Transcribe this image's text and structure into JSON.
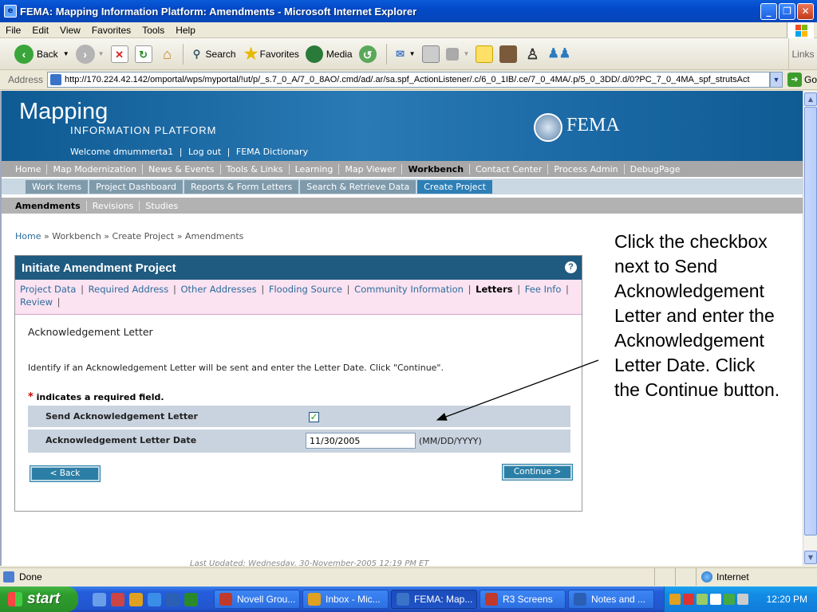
{
  "window": {
    "title": "FEMA: Mapping Information Platform: Amendments - Microsoft Internet Explorer",
    "minimize_icon": "minimize-icon",
    "maximize_icon": "restore-icon",
    "close_icon": "close-icon"
  },
  "menu": [
    "File",
    "Edit",
    "View",
    "Favorites",
    "Tools",
    "Help"
  ],
  "toolbar": {
    "back": "Back",
    "search": "Search",
    "favorites": "Favorites",
    "media": "Media",
    "links": "Links"
  },
  "address": {
    "label": "Address",
    "url": "http://170.224.42.142/omportal/wps/myportal/!ut/p/_s.7_0_A/7_0_8AO/.cmd/ad/.ar/sa.spf_ActionListener/.c/6_0_1IB/.ce/7_0_4MA/.p/5_0_3DD/.d/0?PC_7_0_4MA_spf_strutsAct",
    "go": "Go"
  },
  "banner": {
    "title": "Mapping",
    "subtitle": "INFORMATION PLATFORM",
    "welcome": "Welcome dmummerta1",
    "logout": "Log out",
    "dictionary": "FEMA Dictionary",
    "sep": "|",
    "logo_text": "FEMA"
  },
  "nav_main": [
    "Home",
    "Map Modernization",
    "News & Events",
    "Tools & Links",
    "Learning",
    "Map Viewer",
    "Workbench",
    "Contact Center",
    "Process Admin",
    "DebugPage"
  ],
  "nav_main_active": "Workbench",
  "nav_sub": [
    "Work Items",
    "Project Dashboard",
    "Reports & Form Letters",
    "Search & Retrieve Data",
    "Create Project"
  ],
  "nav_sub_active": "Create Project",
  "nav_tertiary": [
    "Amendments",
    "Revisions",
    "Studies"
  ],
  "breadcrumb": {
    "home": "Home",
    "rest": "» Workbench » Create Project » Amendments"
  },
  "panel": {
    "title": "Initiate Amendment Project",
    "help": "?",
    "steps": [
      "Project Data",
      "Required Address",
      "Other Addresses",
      "Flooding Source",
      "Community Information",
      "Letters",
      "Fee Info",
      "Review"
    ],
    "active_step": "Letters",
    "section_title": "Acknowledgement Letter",
    "instructions": "Identify if an Acknowledgement Letter will be sent and enter the Letter Date. Click \"Continue\".",
    "required_star": "*",
    "required_note": "indicates a required field.",
    "send_label": "Send Acknowledgement Letter",
    "send_checked": true,
    "check_mark": "✓",
    "date_label": "Acknowledgement Letter Date",
    "date_value": "11/30/2005",
    "date_format": "(MM/DD/YYYY)",
    "back_button": "< Back",
    "continue_button": "Continue >"
  },
  "last_updated": "Last Updated: Wednesday, 30-November-2005 12:19 PM ET",
  "annotation": "Click the checkbox next to Send Acknowledgement Letter and enter the Acknowledgement Letter Date. Click the Continue button.",
  "status": {
    "text": "Done",
    "zone": "Internet"
  },
  "taskbar": {
    "start": "start",
    "tasks": [
      {
        "label": "Novell Grou...",
        "color": "#c0392b"
      },
      {
        "label": "Inbox - Mic...",
        "color": "#e0a020"
      },
      {
        "label": "FEMA: Map...",
        "color": "#3a73c7"
      },
      {
        "label": "R3 Screens",
        "color": "#c0392b"
      },
      {
        "label": "Notes and ...",
        "color": "#2b5fb4"
      }
    ],
    "active_task": "FEMA: Map...",
    "clock": "12:20 PM"
  }
}
